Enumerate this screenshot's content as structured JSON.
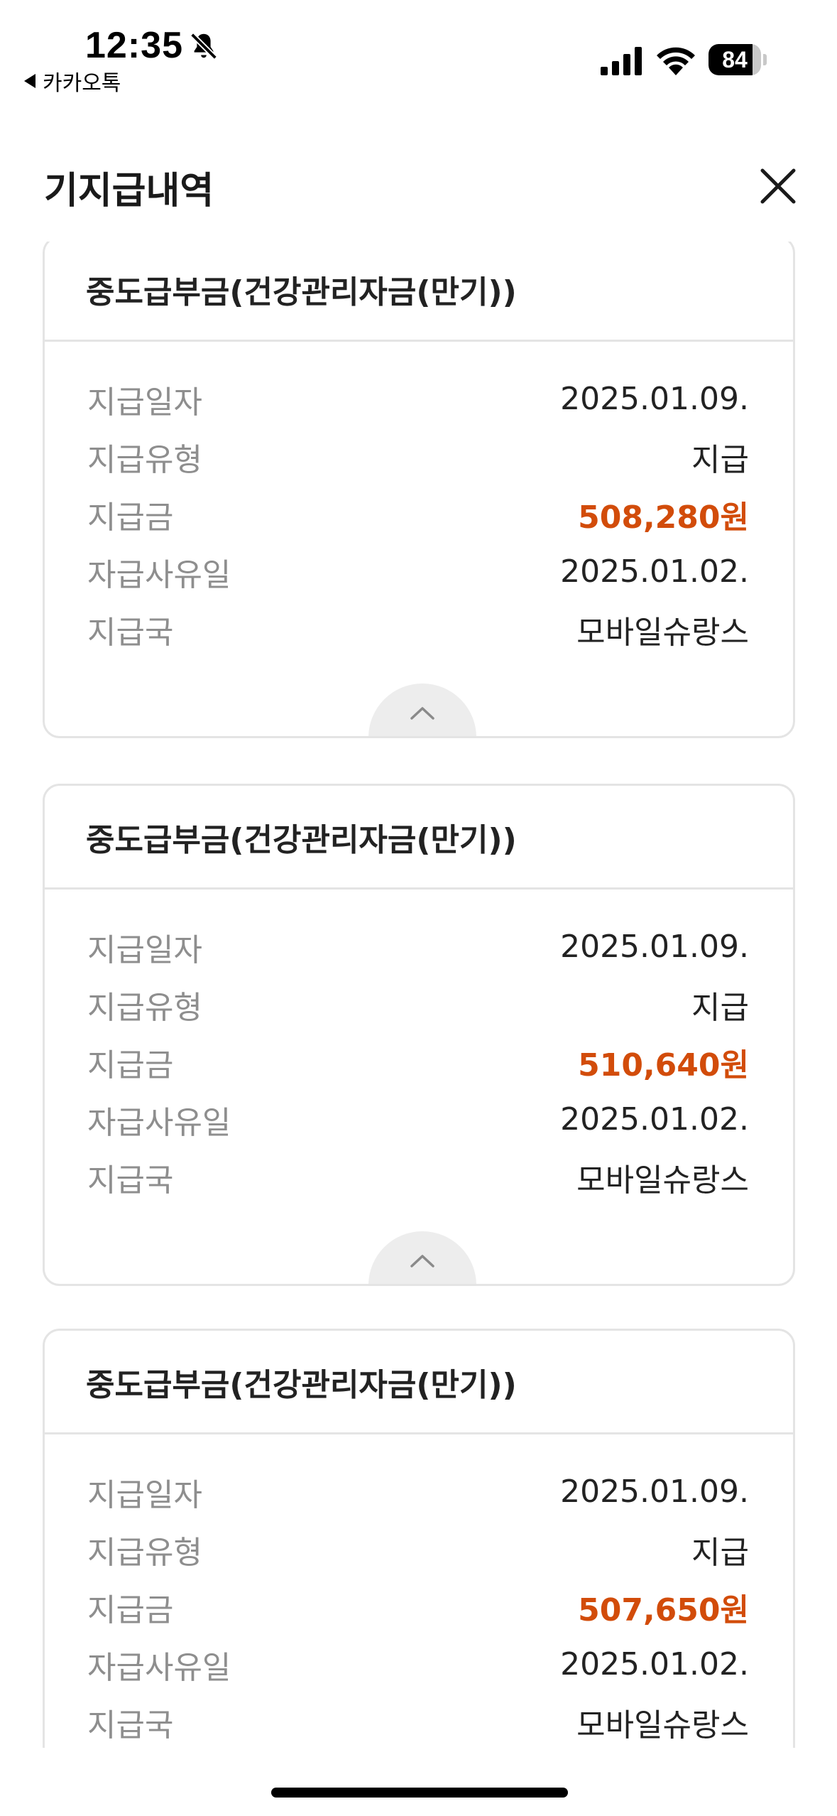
{
  "status_bar": {
    "time": "12:35",
    "back_app": "카카오톡",
    "battery": "84",
    "battery_level": 0.84,
    "icons": [
      "bell-slash-icon",
      "signal-icon",
      "wifi-icon",
      "battery-icon"
    ]
  },
  "header": {
    "title": "기지급내역",
    "close_icon": "close-icon"
  },
  "cards": [
    {
      "title": "중도급부금(건강관리자금(만기))",
      "rows": [
        {
          "label": "지급일자",
          "value": "2025.01.09."
        },
        {
          "label": "지급유형",
          "value": "지급"
        },
        {
          "label": "지급금",
          "value": "508,280원"
        },
        {
          "label": "자급사유일",
          "value": "2025.01.02."
        },
        {
          "label": "지급국",
          "value": "모바일슈랑스"
        }
      ]
    },
    {
      "title": "중도급부금(건강관리자금(만기))",
      "rows": [
        {
          "label": "지급일자",
          "value": "2025.01.09."
        },
        {
          "label": "지급유형",
          "value": "지급"
        },
        {
          "label": "지급금",
          "value": "510,640원"
        },
        {
          "label": "자급사유일",
          "value": "2025.01.02."
        },
        {
          "label": "지급국",
          "value": "모바일슈랑스"
        }
      ]
    },
    {
      "title": "중도급부금(건강관리자금(만기))",
      "rows": [
        {
          "label": "지급일자",
          "value": "2025.01.09."
        },
        {
          "label": "지급유형",
          "value": "지급"
        },
        {
          "label": "지급금",
          "value": "507,650원"
        },
        {
          "label": "자급사유일",
          "value": "2025.01.02."
        },
        {
          "label": "지급국",
          "value": "모바일슈랑스"
        }
      ]
    }
  ],
  "colors": {
    "amount": "#d24c0a",
    "label": "#8e8e8e",
    "border": "#e4e4e4"
  }
}
